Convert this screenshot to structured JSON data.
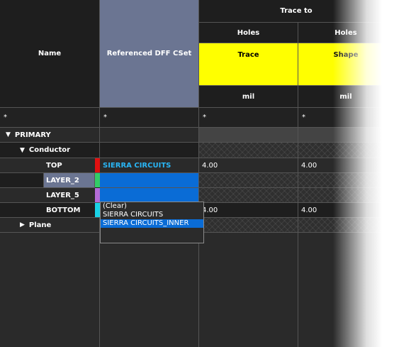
{
  "header": {
    "name": "Name",
    "referenced_dff_cset": "Referenced DFF CSet",
    "trace_to": "Trace to",
    "col1": {
      "holes": "Holes",
      "label": "Trace",
      "unit": "mil"
    },
    "col2": {
      "holes": "Holes",
      "label": "Shape",
      "unit": "mil"
    }
  },
  "filter": {
    "name": "*",
    "cset": "*",
    "col1": "*",
    "col2": "*"
  },
  "rows": {
    "primary": {
      "label": "PRIMARY"
    },
    "conductor": {
      "label": "Conductor"
    },
    "top": {
      "label": "TOP",
      "cset": "SIERRA CIRCUITS",
      "col1": "4.00",
      "col2": "4.00"
    },
    "layer2": {
      "label": "LAYER_2"
    },
    "layer5": {
      "label": "LAYER_5"
    },
    "bottom": {
      "label": "BOTTOM",
      "col1": "4.00",
      "col2": "4.00"
    },
    "plane": {
      "label": "Plane"
    }
  },
  "dropdown": {
    "options": [
      "(Clear)",
      "SIERRA CIRCUITS",
      "SIERRA CIRCUITS_INNER"
    ],
    "selected_index": 2
  },
  "colors": {
    "header_bg": "#1e1e1e",
    "cset_header_bg": "#6b7592",
    "highlight_yellow": "#ffff00",
    "selection_blue": "#0a6cd6",
    "cset_text": "#29b6f6",
    "top_layer": "#e01010",
    "layer2": "#33cc66",
    "layer5": "#b36bd6",
    "bottom_layer": "#19d2e6"
  },
  "icons": {
    "expanded": "triangle-down-icon",
    "collapsed": "triangle-right-icon"
  }
}
